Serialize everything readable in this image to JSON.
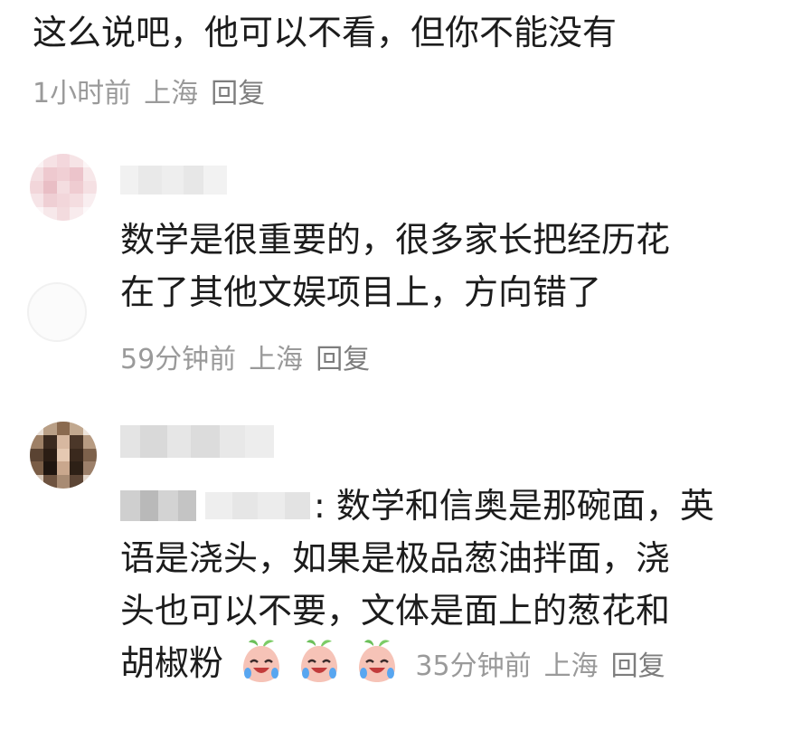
{
  "parent_comment": {
    "text": "这么说吧，他可以不看，但你不能没有",
    "time": "1小时前",
    "location": "上海",
    "reply_label": "回复"
  },
  "replies": [
    {
      "text_lines": [
        "数学是很重要的，很多家长把经历花",
        "在了其他文娱项目上，方向错了"
      ],
      "time": "59分钟前",
      "location": "上海",
      "reply_label": "回复"
    },
    {
      "quote_suffix": ": 数学和信奥是那碗面，英",
      "text_lines": [
        "语是浇头，如果是极品葱油拌面，浇",
        "头也可以不要，文体是面上的葱花和",
        "胡椒粉"
      ],
      "emoji_icon": "laughing-crying-peach-icon",
      "time": "35分钟前",
      "location": "上海",
      "reply_label": "回复"
    }
  ]
}
